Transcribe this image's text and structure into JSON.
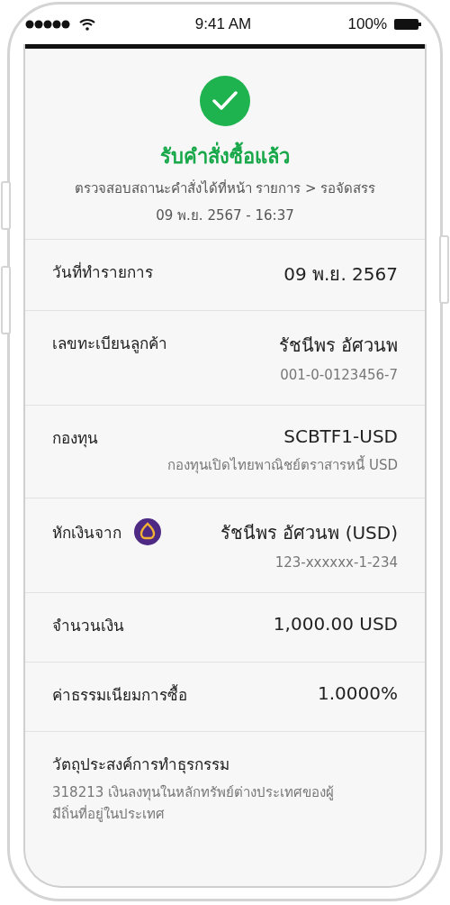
{
  "status_bar": {
    "time": "9:41 AM",
    "battery": "100%"
  },
  "header": {
    "title": "รับคำสั่งซื้อแล้ว",
    "subtitle": "ตรวจสอบสถานะคำสั่งได้ที่หน้า รายการ > รอจัดสรร",
    "timestamp": "09 พ.ย. 2567 - 16:37"
  },
  "details": [
    {
      "kind": "pair",
      "label": "วันที่ทำรายการ",
      "value": "09 พ.ย. 2567"
    },
    {
      "kind": "pair",
      "label": "เลขทะเบียนลูกค้า",
      "value": "รัชนีพร อัศวนพ",
      "sub": "001-0-0123456-7"
    },
    {
      "kind": "pair",
      "label": "กองทุน",
      "value": "SCBTF1-USD",
      "sub": "กองทุนเปิดไทยพาณิชย์ตราสารหนี้ USD"
    },
    {
      "kind": "account",
      "label": "หักเงินจาก",
      "value": "รัชนีพร อัศวนพ (USD)",
      "sub": "123-xxxxxx-1-234"
    },
    {
      "kind": "pair",
      "label": "จำนวนเงิน",
      "value": "1,000.00 USD"
    },
    {
      "kind": "pair",
      "label": "ค่าธรรมเนียมการซื้อ",
      "value": "1.0000%"
    },
    {
      "kind": "stacked",
      "label": "วัตถุประสงค์การทำธุรกรรม",
      "value": "318213 เงินลงทุนในหลักทรัพย์ต่างประเทศของผู้มีถิ่นที่อยู่ในประเทศ"
    }
  ]
}
